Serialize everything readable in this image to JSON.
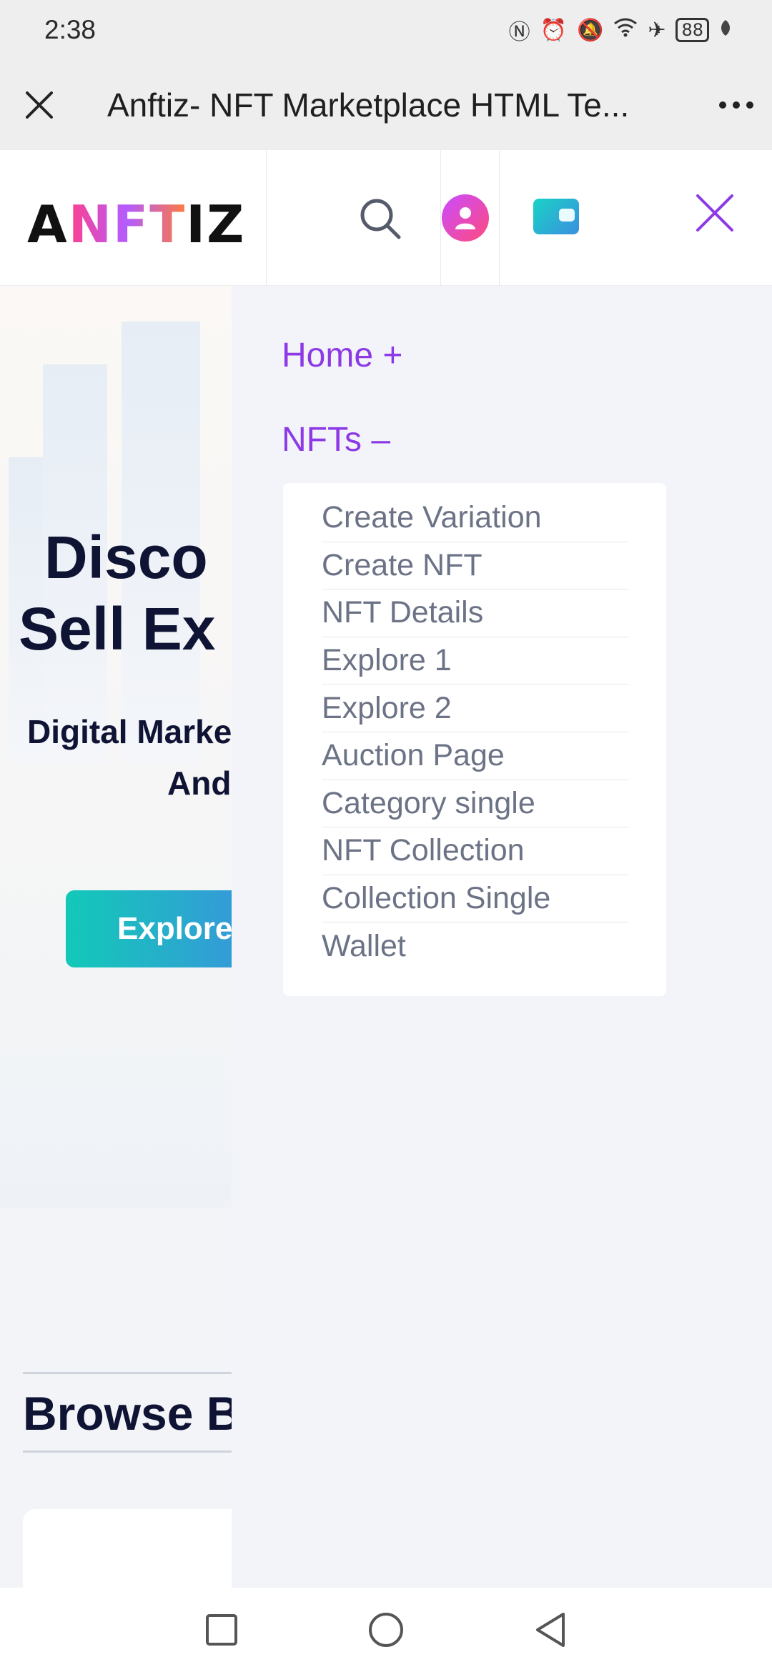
{
  "status_bar": {
    "time": "2:38",
    "battery": "88",
    "icons": [
      "nfc-icon",
      "alarm-icon",
      "mute-icon",
      "wifi-icon",
      "airplane-icon",
      "battery-icon",
      "leaf-icon"
    ]
  },
  "browser": {
    "title": "Anftiz- NFT Marketplace HTML Te..."
  },
  "header": {
    "logo_a": "A",
    "logo_nft": "NFT",
    "logo_iz": "IZ"
  },
  "background": {
    "headline_line1": "Disco",
    "headline_line2": "Sell Ex",
    "subtitle_line1": "Digital Marke",
    "subtitle_line2": "And",
    "explore_button": "Explore",
    "browse_heading": "Browse By"
  },
  "menu": {
    "home": "Home +",
    "nfts": "NFTs –",
    "nfts_submenu": [
      "Create Variation",
      "Create NFT",
      "NFT Details",
      "Explore 1",
      "Explore 2",
      "Auction Page",
      "Category single",
      "NFT Collection",
      "Collection Single",
      "Wallet"
    ]
  },
  "colors": {
    "accent": "#8d3ae6",
    "submenu_text": "#6c7386",
    "heading": "#0f1434"
  }
}
